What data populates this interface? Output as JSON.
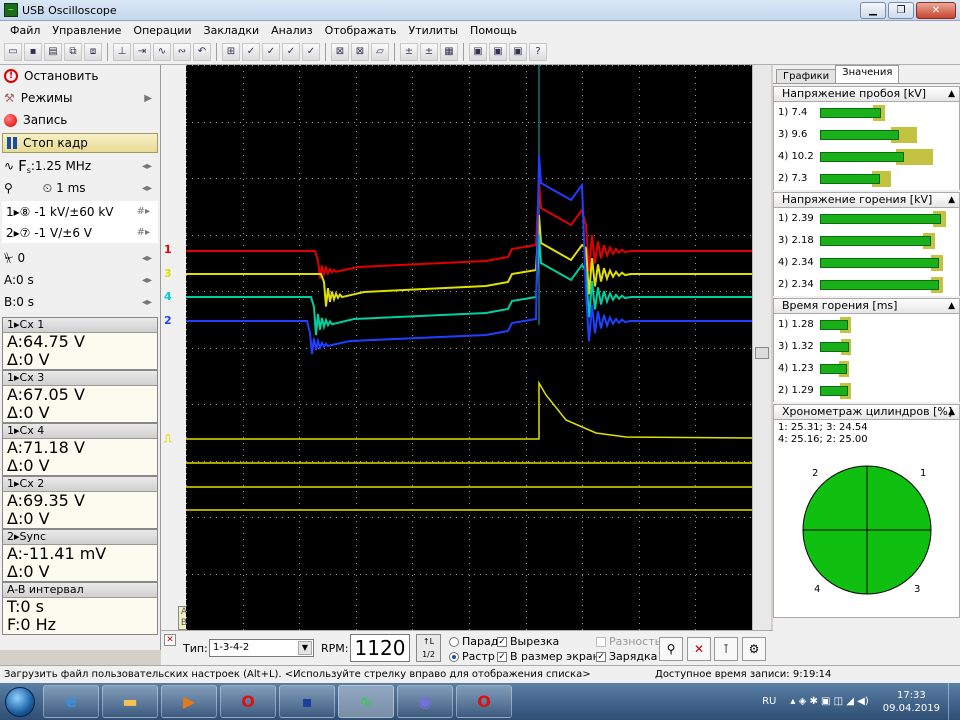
{
  "window": {
    "title": "USB Oscilloscope"
  },
  "menu": [
    "Файл",
    "Управление",
    "Операции",
    "Закладки",
    "Анализ",
    "Отображать",
    "Утилиты",
    "Помощь"
  ],
  "left_panel": {
    "stop_label": "Остановить",
    "modes_label": "Режимы",
    "record_label": "Запись",
    "freeze_label": "Стоп кадр",
    "fs_label": "F",
    "fs_sub": "s",
    "fs_value": ":1.25 MHz",
    "time_value": "1 ms",
    "ch1_label": "1▸⑧ -1 kV/±60 kV",
    "ch2_label": "2▸⑦ -1 V/±6 V",
    "trigger_level": "0",
    "a_time": "A:0 s",
    "b_time": "B:0 s",
    "measurements": [
      {
        "head": "1▸Cx 1",
        "a": "A:64.75 V",
        "d": "Δ:0 V"
      },
      {
        "head": "1▸Cx 3",
        "a": "A:67.05 V",
        "d": "Δ:0 V"
      },
      {
        "head": "1▸Cx 4",
        "a": "A:71.18 V",
        "d": "Δ:0 V"
      },
      {
        "head": "1▸Cx 2",
        "a": "A:69.35 V",
        "d": "Δ:0 V"
      },
      {
        "head": "2▸Sync",
        "a": "A:-11.41 mV",
        "d": "Δ:0 V"
      },
      {
        "head": "A-B интервал",
        "a": "T:0 s",
        "d": "F:0 Hz"
      }
    ]
  },
  "channel_markers": [
    {
      "label": "1",
      "color": "#e00000"
    },
    {
      "label": "3",
      "color": "#e0e000"
    },
    {
      "label": "4",
      "color": "#00d0d0"
    },
    {
      "label": "2",
      "color": "#2040ff"
    },
    {
      "label": "⎍",
      "color": "#e0e000"
    }
  ],
  "right_panel": {
    "tabs": [
      "Графики",
      "Значения"
    ],
    "active_tab": "Значения",
    "sections": [
      {
        "title": "Напряжение пробоя [kV]",
        "rows": [
          {
            "label": "1) 7.4",
            "value": 7.4,
            "max": 7.6
          },
          {
            "label": "3) 9.6",
            "value": 9.6,
            "max": 11.5
          },
          {
            "label": "4) 10.2",
            "value": 10.2,
            "max": 13.5
          },
          {
            "label": "2) 7.3",
            "value": 7.3,
            "max": 8.4
          }
        ],
        "scale": 16
      },
      {
        "title": "Напряжение горения [kV]",
        "rows": [
          {
            "label": "1) 2.39",
            "value": 2.39,
            "max": 2.45
          },
          {
            "label": "3) 2.18",
            "value": 2.18,
            "max": 2.22
          },
          {
            "label": "4) 2.34",
            "value": 2.34,
            "max": 2.38
          },
          {
            "label": "2) 2.34",
            "value": 2.34,
            "max": 2.38
          }
        ],
        "scale": 2.6
      },
      {
        "title": "Время горения [ms]",
        "rows": [
          {
            "label": "1) 1.28",
            "value": 1.28,
            "max": 1.3
          },
          {
            "label": "3) 1.32",
            "value": 1.32,
            "max": 1.34
          },
          {
            "label": "4) 1.23",
            "value": 1.23,
            "max": 1.25
          },
          {
            "label": "2) 1.29",
            "value": 1.29,
            "max": 1.31
          }
        ],
        "scale": 6
      }
    ],
    "chrono_title": "Хронометраж цилиндров [%]",
    "chrono_line1": "1: 25.31;  3: 24.54",
    "chrono_line2": "4: 25.16;  2: 25.00",
    "pie_labels": [
      "1",
      "2",
      "3",
      "4"
    ],
    "pie_color": "#10c010"
  },
  "bottom": {
    "type_label": "Тип:",
    "type_value": "1-3-4-2",
    "rpm_label": "RPM:",
    "rpm_value": "1120",
    "parade": "Парад",
    "raster": "Растр",
    "cutout": "Вырезка",
    "fit_screen": "В размер экрана",
    "difference": "Разность",
    "charge": "Зарядка"
  },
  "status": {
    "hint": "Загрузить файл пользовательских настроек (Alt+L). <Используйте стрелку вправо для отображения списка>",
    "record_time": "Доступное время записи: 9:19:14"
  },
  "taskbar": {
    "lang": "RU",
    "time": "17:33",
    "date": "09.04.2019"
  }
}
